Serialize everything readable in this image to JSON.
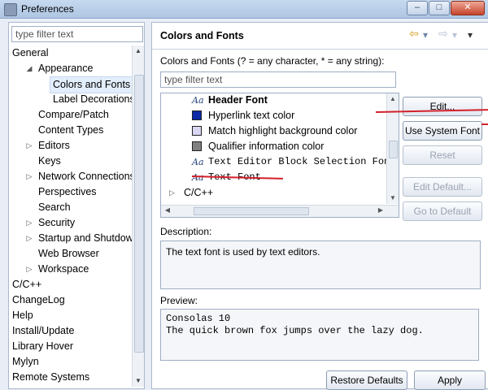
{
  "window": {
    "title": "Preferences",
    "controls": [
      "–",
      "□",
      "✕"
    ]
  },
  "left": {
    "filter_placeholder": "type filter text",
    "tree": [
      {
        "label": "General",
        "level": 0,
        "arrow": "",
        "selected": false
      },
      {
        "label": "Appearance",
        "level": 1,
        "arrow": "◢",
        "selected": false
      },
      {
        "label": "Colors and Fonts",
        "level": 2,
        "arrow": "",
        "selected": true
      },
      {
        "label": "Label Decorations",
        "level": 2,
        "arrow": "",
        "selected": false
      },
      {
        "label": "Compare/Patch",
        "level": 1,
        "arrow": "",
        "selected": false
      },
      {
        "label": "Content Types",
        "level": 1,
        "arrow": "",
        "selected": false
      },
      {
        "label": "Editors",
        "level": 1,
        "arrow": "▷",
        "selected": false
      },
      {
        "label": "Keys",
        "level": 1,
        "arrow": "",
        "selected": false
      },
      {
        "label": "Network Connections",
        "level": 1,
        "arrow": "▷",
        "selected": false
      },
      {
        "label": "Perspectives",
        "level": 1,
        "arrow": "",
        "selected": false
      },
      {
        "label": "Search",
        "level": 1,
        "arrow": "",
        "selected": false
      },
      {
        "label": "Security",
        "level": 1,
        "arrow": "▷",
        "selected": false
      },
      {
        "label": "Startup and Shutdown",
        "level": 1,
        "arrow": "▷",
        "selected": false
      },
      {
        "label": "Web Browser",
        "level": 1,
        "arrow": "",
        "selected": false
      },
      {
        "label": "Workspace",
        "level": 1,
        "arrow": "▷",
        "selected": false
      },
      {
        "label": "C/C++",
        "level": 0,
        "arrow": "",
        "selected": false
      },
      {
        "label": "ChangeLog",
        "level": 0,
        "arrow": "",
        "selected": false
      },
      {
        "label": "Help",
        "level": 0,
        "arrow": "",
        "selected": false
      },
      {
        "label": "Install/Update",
        "level": 0,
        "arrow": "",
        "selected": false
      },
      {
        "label": "Library Hover",
        "level": 0,
        "arrow": "",
        "selected": false
      },
      {
        "label": "Mylyn",
        "level": 0,
        "arrow": "",
        "selected": false
      },
      {
        "label": "Remote Systems",
        "level": 0,
        "arrow": "",
        "selected": false
      }
    ]
  },
  "right": {
    "title": "Colors and Fonts",
    "nav": {
      "back": "⇦",
      "back_menu": "▾",
      "forward": "⇨",
      "forward_menu": "▾",
      "menu": "▾"
    },
    "section_label": "Colors and Fonts (? = any character, * = any string):",
    "filter_placeholder": "type filter text",
    "list": [
      {
        "kind": "font",
        "label": "Header Font",
        "bold": true
      },
      {
        "kind": "color",
        "label": "Hyperlink text color",
        "color": "#0a2aa8"
      },
      {
        "kind": "color",
        "label": "Match highlight background color",
        "color": "#d8d6f2"
      },
      {
        "kind": "color",
        "label": "Qualifier information color",
        "color": "#808080"
      },
      {
        "kind": "font-mono",
        "label": "Text Editor Block Selection Font"
      },
      {
        "kind": "font-mono",
        "label": "Text Font"
      },
      {
        "kind": "folder",
        "label": "C/C++"
      }
    ],
    "buttons": {
      "edit": "Edit...",
      "use_system_font": "Use System Font",
      "reset": "Reset",
      "edit_default": "Edit Default...",
      "go_to_default": "Go to Default"
    },
    "description": {
      "label": "Description:",
      "text": "The text font is used by text editors."
    },
    "preview": {
      "label": "Preview:",
      "lines": [
        "Consolas 10",
        "The quick brown fox jumps over the lazy dog."
      ]
    },
    "bottom": {
      "restore_defaults": "Restore Defaults",
      "apply": "Apply"
    }
  },
  "colors": {
    "annotation_red": "#d3202a"
  }
}
